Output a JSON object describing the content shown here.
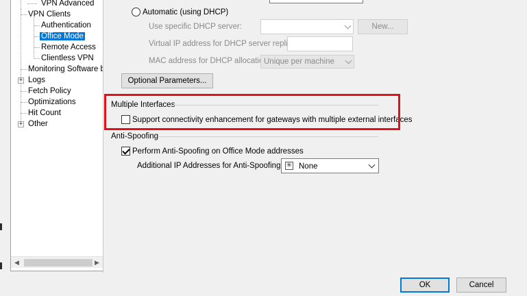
{
  "tree": {
    "items": [
      {
        "label": "VPN Advanced"
      },
      {
        "label": "VPN Clients"
      },
      {
        "label": "Authentication"
      },
      {
        "label": "Office Mode"
      },
      {
        "label": "Remote Access"
      },
      {
        "label": "Clientless VPN"
      },
      {
        "label": "Monitoring Software bl"
      },
      {
        "label": "Logs"
      },
      {
        "label": "Fetch Policy"
      },
      {
        "label": "Optimizations"
      },
      {
        "label": "Hit Count"
      },
      {
        "label": "Other"
      }
    ],
    "selected": "Office Mode"
  },
  "dhcp": {
    "radio_label": "Automatic (using DHCP)",
    "server_label": "Use specific DHCP server:",
    "new_button": "New...",
    "virtual_ip_label": "Virtual IP address for DHCP server replies:",
    "mac_label": "MAC address for DHCP allocation:",
    "mac_value": "Unique per machine"
  },
  "optional_button": "Optional Parameters...",
  "multiple_interfaces": {
    "group_title": "Multiple Interfaces",
    "checkbox_label": "Support connectivity enhancement for gateways with multiple external interfaces",
    "checked": false,
    "highlight_color": "#e0111d"
  },
  "anti_spoofing": {
    "group_title": "Anti-Spoofing",
    "checkbox_label": "Perform Anti-Spoofing on Office Mode addresses",
    "checked": true,
    "additional_label": "Additional IP Addresses for Anti-Spoofing:",
    "additional_value": "None"
  },
  "dialog": {
    "ok": "OK",
    "cancel": "Cancel"
  }
}
